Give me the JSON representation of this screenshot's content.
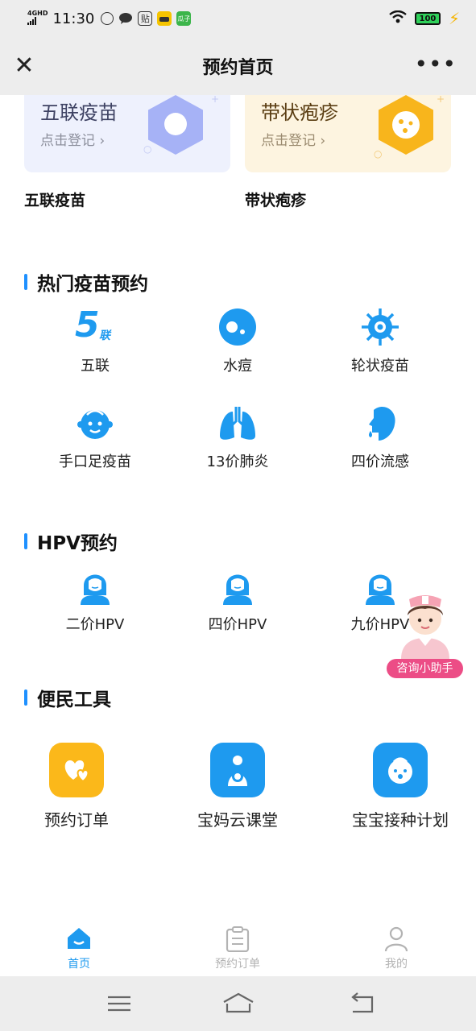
{
  "status_bar": {
    "network": "4GHD",
    "time": "11:30",
    "app_icons": [
      "qq-icon",
      "message-icon",
      "tieba-icon",
      "game-icon",
      "guazi-icon"
    ],
    "app_icon_texts": [
      "",
      "",
      "贴",
      "",
      "瓜子"
    ],
    "battery": "100"
  },
  "header": {
    "title": "预约首页"
  },
  "top_cards": [
    {
      "title": "五联疫苗",
      "subtitle": "点击登记",
      "label": "五联疫苗",
      "color": "#a6b2f6"
    },
    {
      "title": "带状疱疹",
      "subtitle": "点击登记",
      "label": "带状疱疹",
      "color": "#f8b51c"
    }
  ],
  "sections": {
    "hot": {
      "title": "热门疫苗预约",
      "items": [
        {
          "label": "五联",
          "icon": "five-combo-icon"
        },
        {
          "label": "水痘",
          "icon": "chickenpox-icon"
        },
        {
          "label": "轮状疫苗",
          "icon": "rotavirus-icon"
        },
        {
          "label": "手口足疫苗",
          "icon": "hfmd-face-icon"
        },
        {
          "label": "13价肺炎",
          "icon": "lungs-icon"
        },
        {
          "label": "四价流感",
          "icon": "flu-icon"
        }
      ],
      "five_icon_digit": "5",
      "five_icon_char": "联"
    },
    "hpv": {
      "title": "HPV预约",
      "items": [
        {
          "label": "二价HPV",
          "icon": "woman-icon"
        },
        {
          "label": "四价HPV",
          "icon": "woman-icon"
        },
        {
          "label": "九价HPV",
          "icon": "woman-icon"
        }
      ]
    },
    "tools": {
      "title": "便民工具",
      "items": [
        {
          "label": "预约订单",
          "icon": "hearts-icon",
          "color": "#fbb81a"
        },
        {
          "label": "宝妈云课堂",
          "icon": "mother-baby-icon",
          "color": "#1e9aef"
        },
        {
          "label": "宝宝接种计划",
          "icon": "baby-face-icon",
          "color": "#1e9aef"
        }
      ]
    }
  },
  "assistant": {
    "label": "咨询小助手"
  },
  "tabbar": {
    "tabs": [
      {
        "label": "首页",
        "icon": "home-icon",
        "active": true
      },
      {
        "label": "预约订单",
        "icon": "clipboard-icon",
        "active": false
      },
      {
        "label": "我的",
        "icon": "user-icon",
        "active": false
      }
    ]
  },
  "colors": {
    "accent": "#1e9aef",
    "pink": "#ec4d86",
    "amber": "#fbb81a"
  }
}
